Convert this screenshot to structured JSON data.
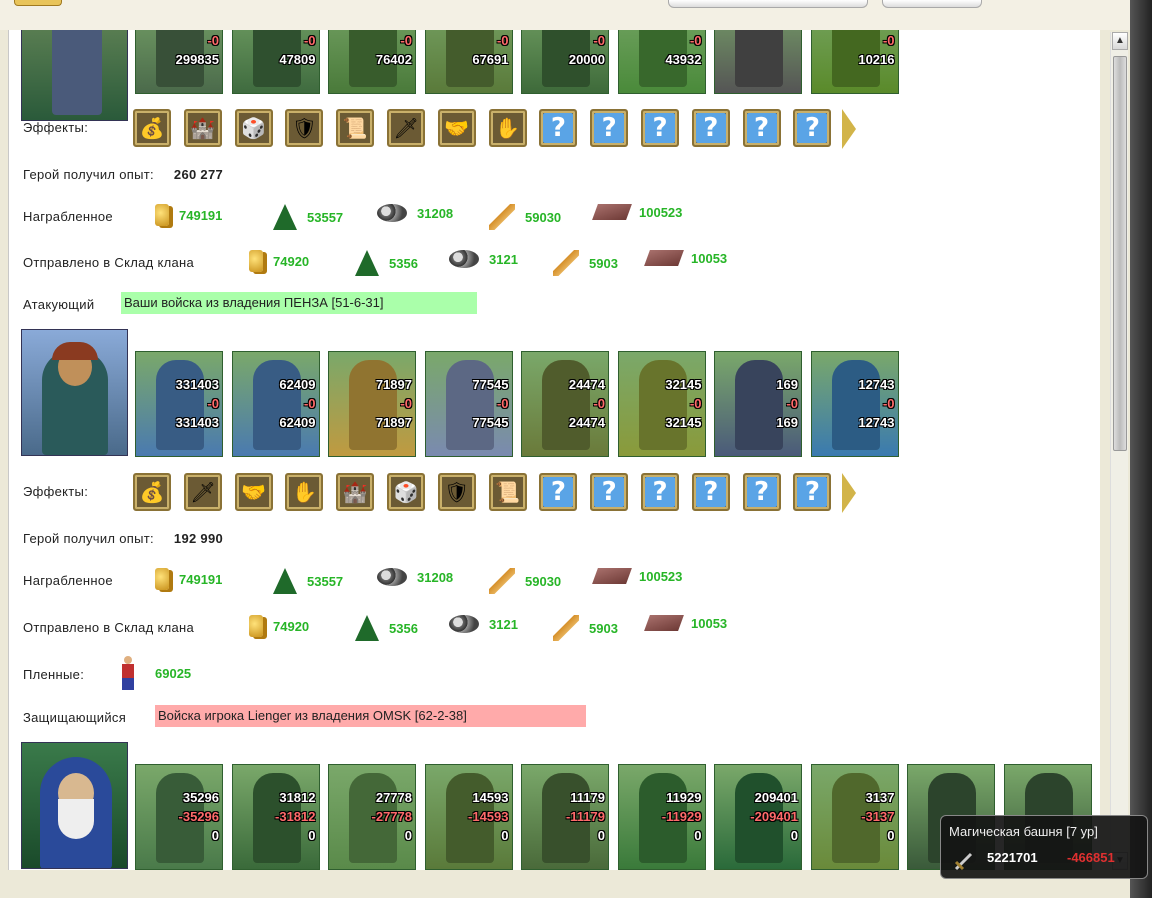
{
  "effects_label": "Эффекты:",
  "arrow_name": "next-arrow-icon",
  "block1": {
    "units": [
      {
        "top": "299835",
        "mid": "-0",
        "bot": "299835",
        "color": "#4b6a4b"
      },
      {
        "top": "47809",
        "mid": "-0",
        "bot": "47809",
        "color": "#3f6b3f"
      },
      {
        "top": "76402",
        "mid": "-0",
        "bot": "76402",
        "color": "#4a7a3a"
      },
      {
        "top": "67691",
        "mid": "-0",
        "bot": "67691",
        "color": "#5a7a3a"
      },
      {
        "top": "20000",
        "mid": "-0",
        "bot": "20000",
        "color": "#3e6a3a"
      },
      {
        "top": "43932",
        "mid": "-0",
        "bot": "43932",
        "color": "#4a8a3a"
      },
      {
        "top": "",
        "mid": "",
        "bot": "",
        "color": "#555555"
      },
      {
        "top": "10216",
        "mid": "-0",
        "bot": "10216",
        "color": "#5a8a2a"
      }
    ],
    "effects": [
      "bag-icon",
      "fortress-icon",
      "dice-icon",
      "shield-icon",
      "scroll-icon",
      "sword-icon",
      "handshake-icon",
      "hand-icon",
      "?",
      "?",
      "?",
      "?",
      "?",
      "?"
    ],
    "exp_label": "Герой получил опыт:",
    "exp_value": "260 277",
    "plunder_label": "Награбленное",
    "plunder": [
      "749191",
      "53557",
      "31208",
      "59030",
      "100523"
    ],
    "sent_label": "Отправлено в Склад клана",
    "sent": [
      "74920",
      "5356",
      "3121",
      "5903",
      "10053"
    ]
  },
  "attacker": {
    "label": "Атакующий",
    "bar_text": "Ваши войска из владения ПЕНЗА [51-6-31]",
    "units": [
      {
        "top": "331403",
        "mid": "-0",
        "bot": "331403",
        "color": "#4a7ab0"
      },
      {
        "top": "62409",
        "mid": "-0",
        "bot": "62409",
        "color": "#4a7ab0"
      },
      {
        "top": "71897",
        "mid": "-0",
        "bot": "71897",
        "color": "#c09a40"
      },
      {
        "top": "77545",
        "mid": "-0",
        "bot": "77545",
        "color": "#7a8ab0"
      },
      {
        "top": "24474",
        "mid": "-0",
        "bot": "24474",
        "color": "#6a7a3a"
      },
      {
        "top": "32145",
        "mid": "-0",
        "bot": "32145",
        "color": "#8a9a3a"
      },
      {
        "top": "169",
        "mid": "-0",
        "bot": "169",
        "color": "#4a5a7a"
      },
      {
        "top": "12743",
        "mid": "-0",
        "bot": "12743",
        "color": "#3a7ab0"
      }
    ],
    "effects": [
      "bag-icon",
      "sword-icon",
      "handshake-icon",
      "hand-icon",
      "fortress-icon",
      "dice-icon",
      "shield-icon",
      "scroll-icon",
      "?",
      "?",
      "?",
      "?",
      "?",
      "?"
    ],
    "exp_label": "Герой получил опыт:",
    "exp_value": "192 990",
    "plunder_label": "Награбленное",
    "plunder": [
      "749191",
      "53557",
      "31208",
      "59030",
      "100523"
    ],
    "sent_label": "Отправлено в Склад клана",
    "sent": [
      "74920",
      "5356",
      "3121",
      "5903",
      "10053"
    ],
    "prisoners_label": "Пленные:",
    "prisoners_value": "69025"
  },
  "defender": {
    "label": "Защищающийся",
    "bar_text": "Войска игрока Lienger из владения OMSK [62-2-38]",
    "units": [
      {
        "top": "35296",
        "mid": "-35296",
        "bot": "0",
        "color": "#4a7a4a"
      },
      {
        "top": "31812",
        "mid": "-31812",
        "bot": "0",
        "color": "#3a6a3a"
      },
      {
        "top": "27778",
        "mid": "-27778",
        "bot": "0",
        "color": "#5a8a4a"
      },
      {
        "top": "14593",
        "mid": "-14593",
        "bot": "0",
        "color": "#5a7a3a"
      },
      {
        "top": "11179",
        "mid": "-11179",
        "bot": "0",
        "color": "#4a6a3a"
      },
      {
        "top": "11929",
        "mid": "-11929",
        "bot": "0",
        "color": "#3a7a3a"
      },
      {
        "top": "209401",
        "mid": "-209401",
        "bot": "0",
        "color": "#2a6a3a"
      },
      {
        "top": "3137",
        "mid": "-3137",
        "bot": "0",
        "color": "#6a8a3a"
      },
      {
        "top": "",
        "mid": "",
        "bot": "",
        "color": "#3a5a3a"
      },
      {
        "top": "",
        "mid": "",
        "bot": "",
        "color": "#3a5a3a"
      }
    ]
  },
  "tooltip": {
    "title": "Магическая башня [7 ур]",
    "value": "5221701",
    "loss": "-466851"
  },
  "colors": {
    "resource_green": "#27b527",
    "attacker_bar": "#aaffaa",
    "defender_bar": "#ffaaaa"
  }
}
